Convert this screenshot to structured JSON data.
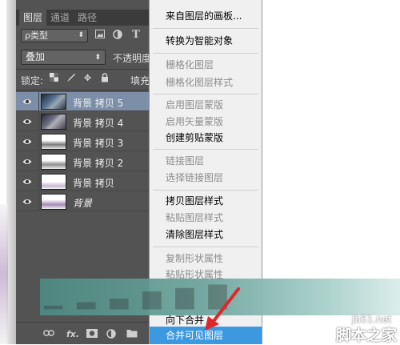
{
  "layers_panel": {
    "tabs": [
      "图层",
      "通道",
      "路径"
    ],
    "filter_kind": "ρ类型",
    "filter_icons": [
      "image-filter-icon",
      "adjustment-filter-icon",
      "type-filter-icon"
    ],
    "blend_mode": "叠加",
    "opacity_label": "不透明度",
    "lock_label": "锁定:",
    "fill_label": "填充",
    "layers": [
      {
        "name": "背景 拷贝 5",
        "selected": true
      },
      {
        "name": "背景 拷贝 4",
        "selected": false
      },
      {
        "name": "背景 拷贝 3",
        "selected": false
      },
      {
        "name": "背景 拷贝 2",
        "selected": false
      },
      {
        "name": "背景 拷贝",
        "selected": false
      },
      {
        "name": "背景",
        "selected": false
      }
    ],
    "bottom_icons": [
      "link-icon",
      "fx-icon",
      "mask-icon",
      "adjustment-icon",
      "folder-icon"
    ],
    "fx_text": "fx."
  },
  "context_menu": {
    "items": [
      {
        "label": "来自图层的画板...",
        "enabled": true
      },
      {
        "label": "转换为智能对象",
        "enabled": true
      },
      {
        "label": "栅格化图层",
        "enabled": false
      },
      {
        "label": "栅格化图层样式",
        "enabled": false
      },
      {
        "label": "启用图层蒙版",
        "enabled": false
      },
      {
        "label": "启用矢量蒙版",
        "enabled": false
      },
      {
        "label": "创建剪贴蒙版",
        "enabled": true
      },
      {
        "label": "链接图层",
        "enabled": false
      },
      {
        "label": "选择链接图层",
        "enabled": false
      },
      {
        "label": "拷贝图层样式",
        "enabled": true
      },
      {
        "label": "粘贴图层样式",
        "enabled": false
      },
      {
        "label": "清除图层样式",
        "enabled": true
      },
      {
        "label": "复制形状属性",
        "enabled": false
      },
      {
        "label": "粘贴形状属性",
        "enabled": false
      },
      {
        "label": "向下合并",
        "enabled": true
      },
      {
        "label": "合并可见图层",
        "enabled": true,
        "highlighted": true
      }
    ]
  },
  "watermark": {
    "site": "jb51.net",
    "brand": "脚本之家"
  },
  "colors": {
    "panel_bg": "#535353",
    "selected_layer": "#7d8fa8",
    "menu_highlight": "#3c99e0",
    "arrow": "#e0262b"
  }
}
